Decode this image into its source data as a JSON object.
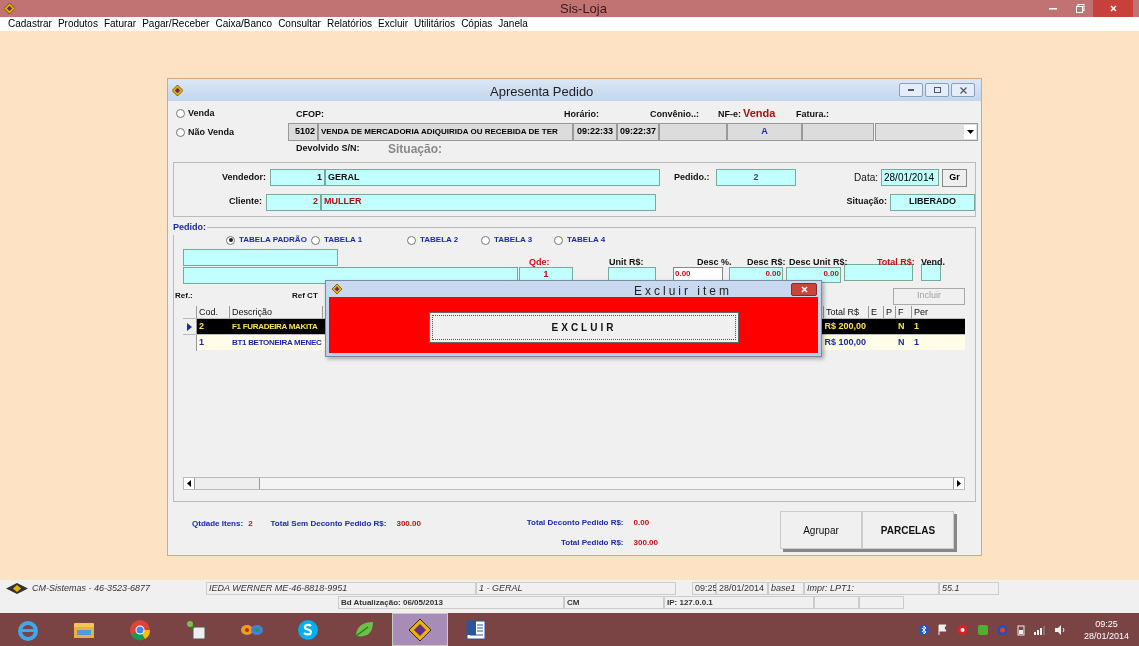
{
  "app_title": "Sis-Loja",
  "menu": [
    "Cadastrar",
    "Produtos",
    "Faturar",
    "Pagar/Receber",
    "Caixa/Banco",
    "Consultar",
    "Relatórios",
    "Excluir",
    "Utilitários",
    "Cópias",
    "Janela"
  ],
  "window": {
    "title": "Apresenta Pedido"
  },
  "sale_type": [
    {
      "label": "Venda",
      "selected": false
    },
    {
      "label": "Não Venda",
      "selected": false
    }
  ],
  "header": {
    "cfop_label": "CFOP:",
    "cfop_code": "5102",
    "cfop_desc": "VENDA DE MERCADORIA ADIQUIRIDA OU RECEBIDA DE TER",
    "horario_label": "Horário:",
    "time_start": "09:22:33",
    "time_end": "09:22:37",
    "convenio_label": "Convênio..:",
    "nfe_label": "NF-e:",
    "nfe_kind": "Venda",
    "nfe_value": "A",
    "fatura_label": "Fatura.:",
    "devolvido_label": "Devolvido S/N:",
    "situacao_label": "Situação:"
  },
  "order": {
    "vendedor_label": "Vendedor:",
    "vendedor_code": "1",
    "vendedor_name": "GERAL",
    "cliente_label": "Cliente:",
    "cliente_code": "2",
    "cliente_name": "MULLER",
    "pedido_label": "Pedido.:",
    "pedido": "2",
    "data_label": "Data:",
    "data": "28/01/2014",
    "gr_button": "Gr",
    "situacao_label": "Situação:",
    "situacao": "LIBERADO"
  },
  "pedido": {
    "label": "Pedido:",
    "price_tables": [
      {
        "label": "TABELA PADRÃO",
        "selected": true
      },
      {
        "label": "TABELA 1",
        "selected": false
      },
      {
        "label": "TABELA 2",
        "selected": false
      },
      {
        "label": "TABELA 3",
        "selected": false
      },
      {
        "label": "TABELA 4",
        "selected": false
      }
    ],
    "qde_label": "Qde:",
    "unit_label": "Unit R$:",
    "desc_pct_label": "Desc %.",
    "desc_rs_label": "Desc R$:",
    "desc_unit_label": "Desc Unit R$:",
    "total_label": "Total R$:",
    "vend_label": "Vend.",
    "qde": "1",
    "desc_pct": "0.00",
    "desc_rs": "0.00",
    "desc_unit": "0.00",
    "ref_label": "Ref.:",
    "ref_ct_label": "Ref CT",
    "incluir": {
      "label": "Incluir",
      "disabled": true
    },
    "columns_left": [
      "Cod.",
      "Descrição"
    ],
    "columns_right": [
      "Total R$",
      "E",
      "P",
      "F",
      "Per"
    ],
    "rows": [
      {
        "selected": true,
        "cod": "2",
        "descricao": "F1 FURADEIRA MAKITA",
        "total": "R$ 200,00",
        "f": "N",
        "per": "1"
      },
      {
        "selected": false,
        "cod": "1",
        "descricao": "BT1 BETONEIRA MENEC",
        "total": "R$ 100,00",
        "f": "N",
        "per": "1"
      }
    ]
  },
  "totals": {
    "qtd_label": "Qtdade Itens:",
    "qtd": "2",
    "sem_desc_label": "Total Sem Deconto Pedido R$:",
    "sem_desc": "300.00",
    "desc_label": "Total Deconto Pedido R$:",
    "desc": "0.00",
    "total_label": "Total Pedido R$:",
    "total": "300.00"
  },
  "buttons": [
    "Agrupar",
    "PARCELAS"
  ],
  "dialog": {
    "title": "Excluir item",
    "button": "EXCLUIR"
  },
  "status_bar": {
    "company": "CM-Sistemas - 46-3523-6877",
    "client": "IEDA WERNER ME-46-8818-9951",
    "user": "1 - GERAL",
    "time": "09:25",
    "date": "28/01/2014",
    "base": "base1",
    "printer": "Impr: LPT1:",
    "version": "55.1",
    "db_update": "Bd Atualização: 06/05/2013",
    "station": "CM",
    "ip": "IP: 127.0.0.1"
  },
  "taskbar": {
    "time": "09:25",
    "date": "28/01/2014"
  }
}
